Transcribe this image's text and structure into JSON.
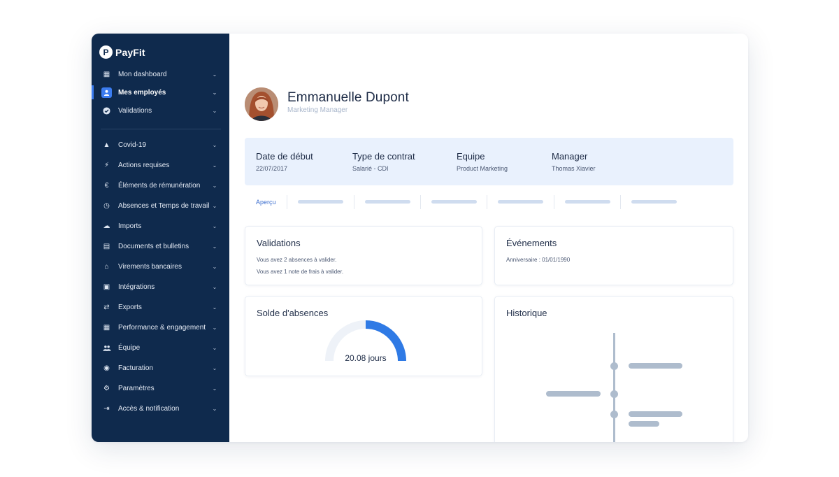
{
  "app": {
    "brand": "PayFit",
    "brand_logo_letter": "P"
  },
  "sidebar": {
    "items": [
      {
        "label": "Mon dashboard",
        "icon": "dashboard-icon",
        "glyph": "▦",
        "active": false
      },
      {
        "label": "Mes employés",
        "icon": "user-icon",
        "glyph": "👤",
        "active": true
      },
      {
        "label": "Validations",
        "icon": "check-circle-icon",
        "glyph": "✔",
        "active": false
      },
      {
        "label": "Covid-19",
        "icon": "warning-icon",
        "glyph": "▲",
        "active": false
      },
      {
        "label": "Actions requises",
        "icon": "lightning-icon",
        "glyph": "⚡",
        "active": false
      },
      {
        "label": "Éléments de rémunération",
        "icon": "euro-icon",
        "glyph": "€",
        "active": false
      },
      {
        "label": "Absences et Temps de travail",
        "icon": "clock-icon",
        "glyph": "◷",
        "active": false
      },
      {
        "label": "Imports",
        "icon": "cloud-upload-icon",
        "glyph": "☁",
        "active": false
      },
      {
        "label": "Documents et bulletins",
        "icon": "document-icon",
        "glyph": "▤",
        "active": false
      },
      {
        "label": "Virements bancaires",
        "icon": "bank-icon",
        "glyph": "⌂",
        "active": false
      },
      {
        "label": "Intégrations",
        "icon": "clipboard-icon",
        "glyph": "▣",
        "active": false
      },
      {
        "label": "Exports",
        "icon": "transfer-icon",
        "glyph": "⇄",
        "active": false
      },
      {
        "label": "Performance & engagement",
        "icon": "grid-icon",
        "glyph": "▦",
        "active": false
      },
      {
        "label": "Équipe",
        "icon": "team-icon",
        "glyph": "👥",
        "active": false
      },
      {
        "label": "Facturation",
        "icon": "billing-icon",
        "glyph": "◉",
        "active": false
      },
      {
        "label": "Paramètres",
        "icon": "gear-icon",
        "glyph": "⚙",
        "active": false
      },
      {
        "label": "Accès & notification",
        "icon": "login-icon",
        "glyph": "⇥",
        "active": false
      }
    ],
    "chevron": "⌄"
  },
  "employee": {
    "name": "Emmanuelle Dupont",
    "role": "Marketing Manager"
  },
  "info": [
    {
      "label": "Date de début",
      "value": "22/07/2017"
    },
    {
      "label": "Type de contrat",
      "value": "Salarié - CDI"
    },
    {
      "label": "Equipe",
      "value": "Product Marketing"
    },
    {
      "label": "Manager",
      "value": "Thomas Xiavier"
    }
  ],
  "tabs": {
    "active_label": "Aperçu"
  },
  "validations": {
    "title": "Validations",
    "lines": [
      "Vous avez 2 absences à valider.",
      "Vous avez 1 note de frais à valider."
    ]
  },
  "events": {
    "title": "Événements",
    "lines": [
      "Anniversaire : 01/01/1990"
    ]
  },
  "absences": {
    "title": "Solde d'absences",
    "value_label": "20.08 jours",
    "progress": 0.5
  },
  "history": {
    "title": "Historique"
  },
  "colors": {
    "sidebar": "#0f2a4d",
    "accent": "#3b7cf0",
    "info_band": "#e9f1fd",
    "placeholder": "#aebccd"
  }
}
